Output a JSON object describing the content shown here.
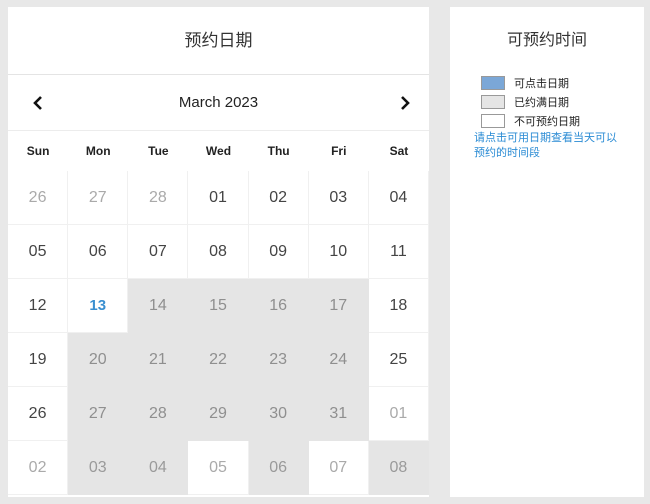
{
  "calendar": {
    "title": "预约日期",
    "month_label": "March 2023",
    "weekdays": [
      "Sun",
      "Mon",
      "Tue",
      "Wed",
      "Thu",
      "Fri",
      "Sat"
    ],
    "days": [
      {
        "label": "26",
        "state": "other"
      },
      {
        "label": "27",
        "state": "other"
      },
      {
        "label": "28",
        "state": "other"
      },
      {
        "label": "01",
        "state": "cur"
      },
      {
        "label": "02",
        "state": "cur"
      },
      {
        "label": "03",
        "state": "cur"
      },
      {
        "label": "04",
        "state": "cur"
      },
      {
        "label": "05",
        "state": "cur"
      },
      {
        "label": "06",
        "state": "cur"
      },
      {
        "label": "07",
        "state": "cur"
      },
      {
        "label": "08",
        "state": "cur"
      },
      {
        "label": "09",
        "state": "cur"
      },
      {
        "label": "10",
        "state": "cur"
      },
      {
        "label": "11",
        "state": "cur"
      },
      {
        "label": "12",
        "state": "cur"
      },
      {
        "label": "13",
        "state": "today"
      },
      {
        "label": "14",
        "state": "full"
      },
      {
        "label": "15",
        "state": "full"
      },
      {
        "label": "16",
        "state": "full"
      },
      {
        "label": "17",
        "state": "full"
      },
      {
        "label": "18",
        "state": "cur"
      },
      {
        "label": "19",
        "state": "cur"
      },
      {
        "label": "20",
        "state": "full"
      },
      {
        "label": "21",
        "state": "full"
      },
      {
        "label": "22",
        "state": "full"
      },
      {
        "label": "23",
        "state": "full"
      },
      {
        "label": "24",
        "state": "full"
      },
      {
        "label": "25",
        "state": "cur"
      },
      {
        "label": "26",
        "state": "cur"
      },
      {
        "label": "27",
        "state": "full"
      },
      {
        "label": "28",
        "state": "full"
      },
      {
        "label": "29",
        "state": "full"
      },
      {
        "label": "30",
        "state": "full"
      },
      {
        "label": "31",
        "state": "full"
      },
      {
        "label": "01",
        "state": "other"
      },
      {
        "label": "02",
        "state": "other"
      },
      {
        "label": "03",
        "state": "full-other"
      },
      {
        "label": "04",
        "state": "full-other"
      },
      {
        "label": "05",
        "state": "other"
      },
      {
        "label": "06",
        "state": "full-other"
      },
      {
        "label": "07",
        "state": "other"
      },
      {
        "label": "08",
        "state": "full-other"
      }
    ]
  },
  "availability": {
    "title": "可预约时间",
    "legend": [
      {
        "label": "可点击日期",
        "color": "#7ba7d7"
      },
      {
        "label": "已约满日期",
        "color": "#e5e5e5"
      },
      {
        "label": "不可预约日期",
        "color": "#ffffff"
      }
    ],
    "hint": "请点击可用日期查看当天可以预约的时间段"
  }
}
